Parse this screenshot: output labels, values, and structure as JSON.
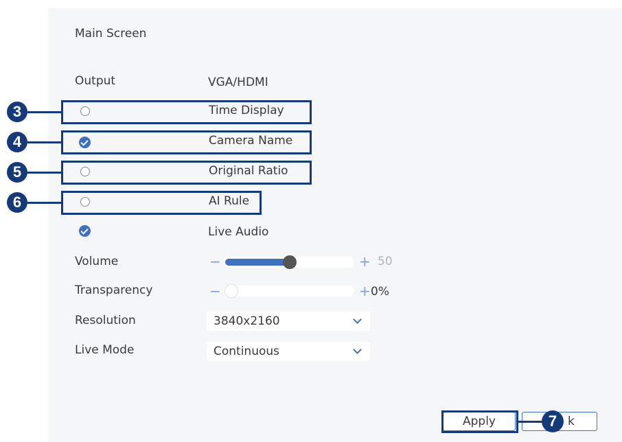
{
  "page": {
    "title": "Main Screen",
    "output": {
      "label": "Output",
      "value": "VGA/HDMI"
    }
  },
  "options": [
    {
      "label": "Time Display",
      "checked": false,
      "callout": "3"
    },
    {
      "label": "Camera Name",
      "checked": true,
      "callout": "4"
    },
    {
      "label": "Original Ratio",
      "checked": false,
      "callout": "5"
    },
    {
      "label": "AI Rule",
      "checked": false,
      "callout": "6"
    },
    {
      "label": "Live Audio",
      "checked": true
    }
  ],
  "volume": {
    "label": "Volume",
    "minus": "−",
    "plus": "+",
    "value": 50,
    "value_text": "50"
  },
  "transparency": {
    "label": "Transparency",
    "minus": "−",
    "plus": "+",
    "value": 0,
    "value_text": "0%"
  },
  "resolution": {
    "label": "Resolution",
    "value": "3840x2160"
  },
  "live_mode": {
    "label": "Live Mode",
    "value": "Continuous"
  },
  "buttons": {
    "apply": "Apply",
    "back_partial": "k",
    "apply_callout": "7"
  },
  "colors": {
    "accent": "#3e6fc1",
    "callout": "#143a7a",
    "panel": "#f5f6f8"
  },
  "icons": {
    "checked": "check-circle-icon",
    "unchecked": "radio-empty-icon",
    "dropdown": "chevron-down-icon"
  }
}
